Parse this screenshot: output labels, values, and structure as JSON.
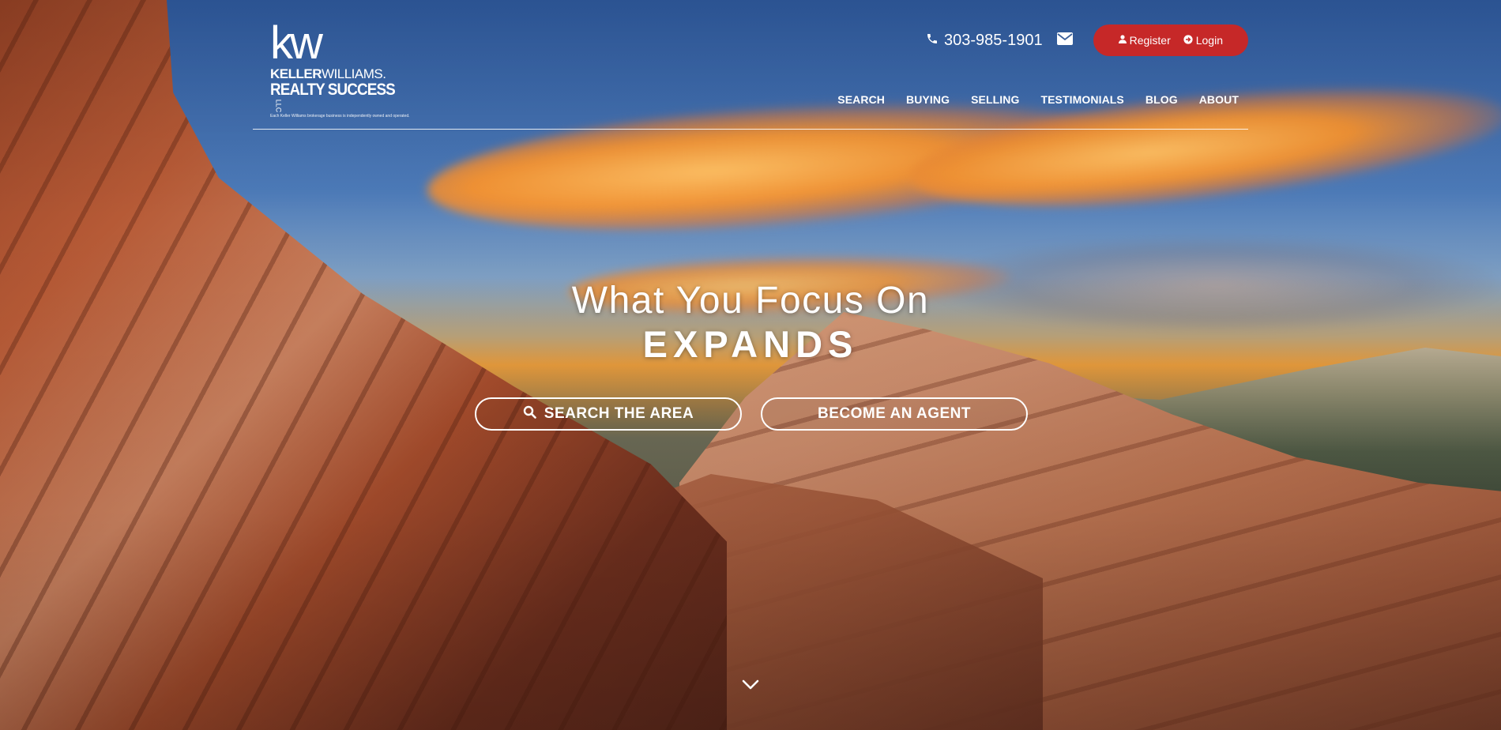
{
  "brand": {
    "logo_mark": "kw",
    "name_bold": "KELLER",
    "name_regular": "WILLIAMS.",
    "subtitle": "REALTY SUCCESS",
    "suffix": "LLC",
    "disclaimer": "Each Keller Williams brokerage business is independently owned and operated."
  },
  "contact": {
    "phone": "303-985-1901",
    "phone_icon": "phone-icon",
    "email_icon": "envelope-icon"
  },
  "auth": {
    "register_label": "Register",
    "login_label": "Login",
    "bg_color": "#c62828"
  },
  "nav": {
    "items": [
      {
        "label": "SEARCH"
      },
      {
        "label": "BUYING"
      },
      {
        "label": "SELLING"
      },
      {
        "label": "TESTIMONIALS"
      },
      {
        "label": "BLOG"
      },
      {
        "label": "ABOUT"
      }
    ]
  },
  "hero": {
    "tagline": "What You Focus On",
    "tagline_strong": "EXPANDS",
    "cta_search": "SEARCH THE AREA",
    "cta_agent": "BECOME AN AGENT",
    "scroll_icon": "chevron-down-icon"
  }
}
